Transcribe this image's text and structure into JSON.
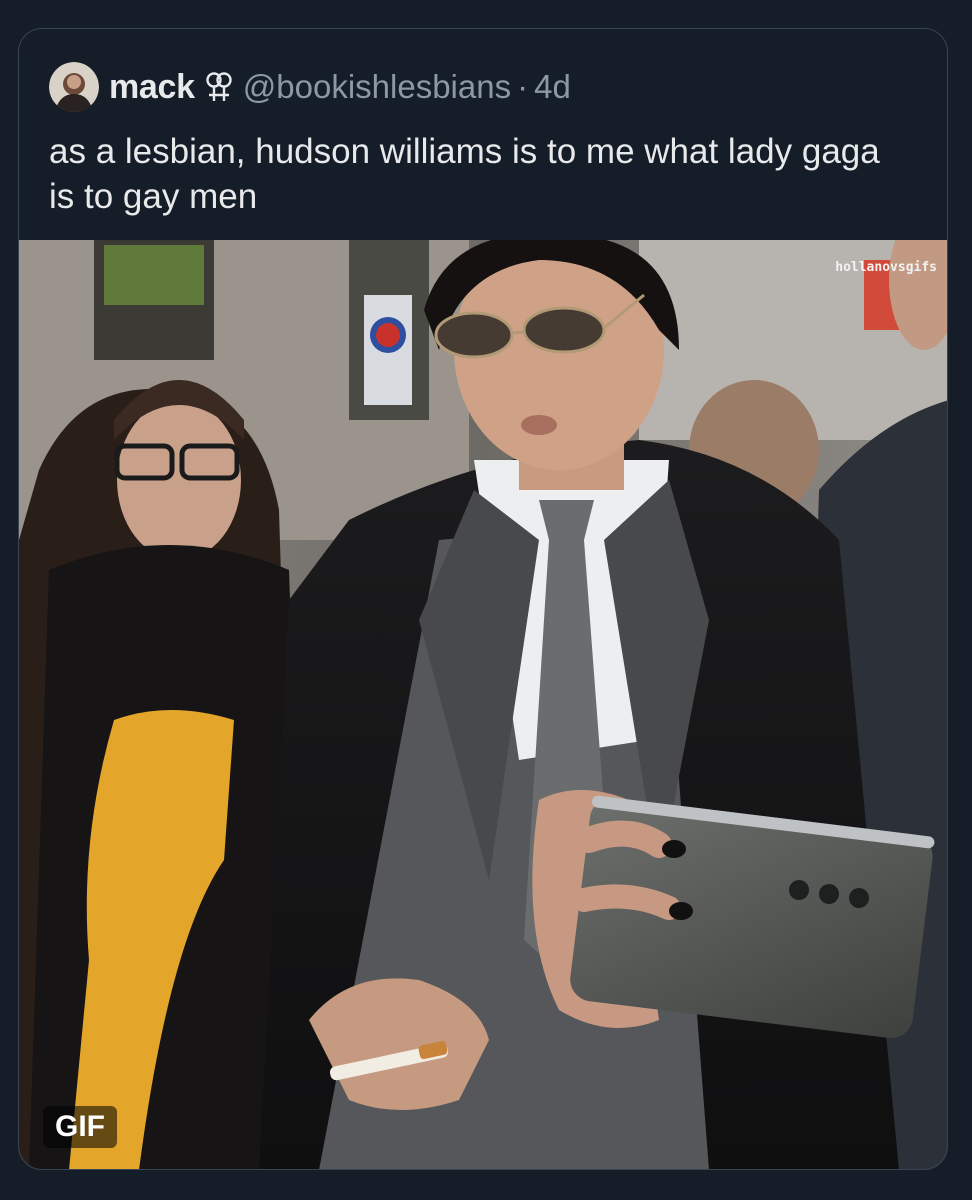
{
  "tweet": {
    "display_name": "mack",
    "symbol_icon": "double-venus-symbol-icon",
    "handle": "@bookishlesbians",
    "separator": "·",
    "time_ago": "4d",
    "text": "as a lesbian, hudson williams is to me what lady gaga is to gay men"
  },
  "media": {
    "type": "gif",
    "badge_label": "GIF",
    "watermark": "hollanovsgifs",
    "description_icons": [
      "man-in-suit-sunglasses-holding-phone-and-cigarette"
    ]
  },
  "colors": {
    "background": "#151d28",
    "text_primary": "#e7e9ea",
    "text_secondary": "#8b98a5",
    "border": "#384452"
  }
}
